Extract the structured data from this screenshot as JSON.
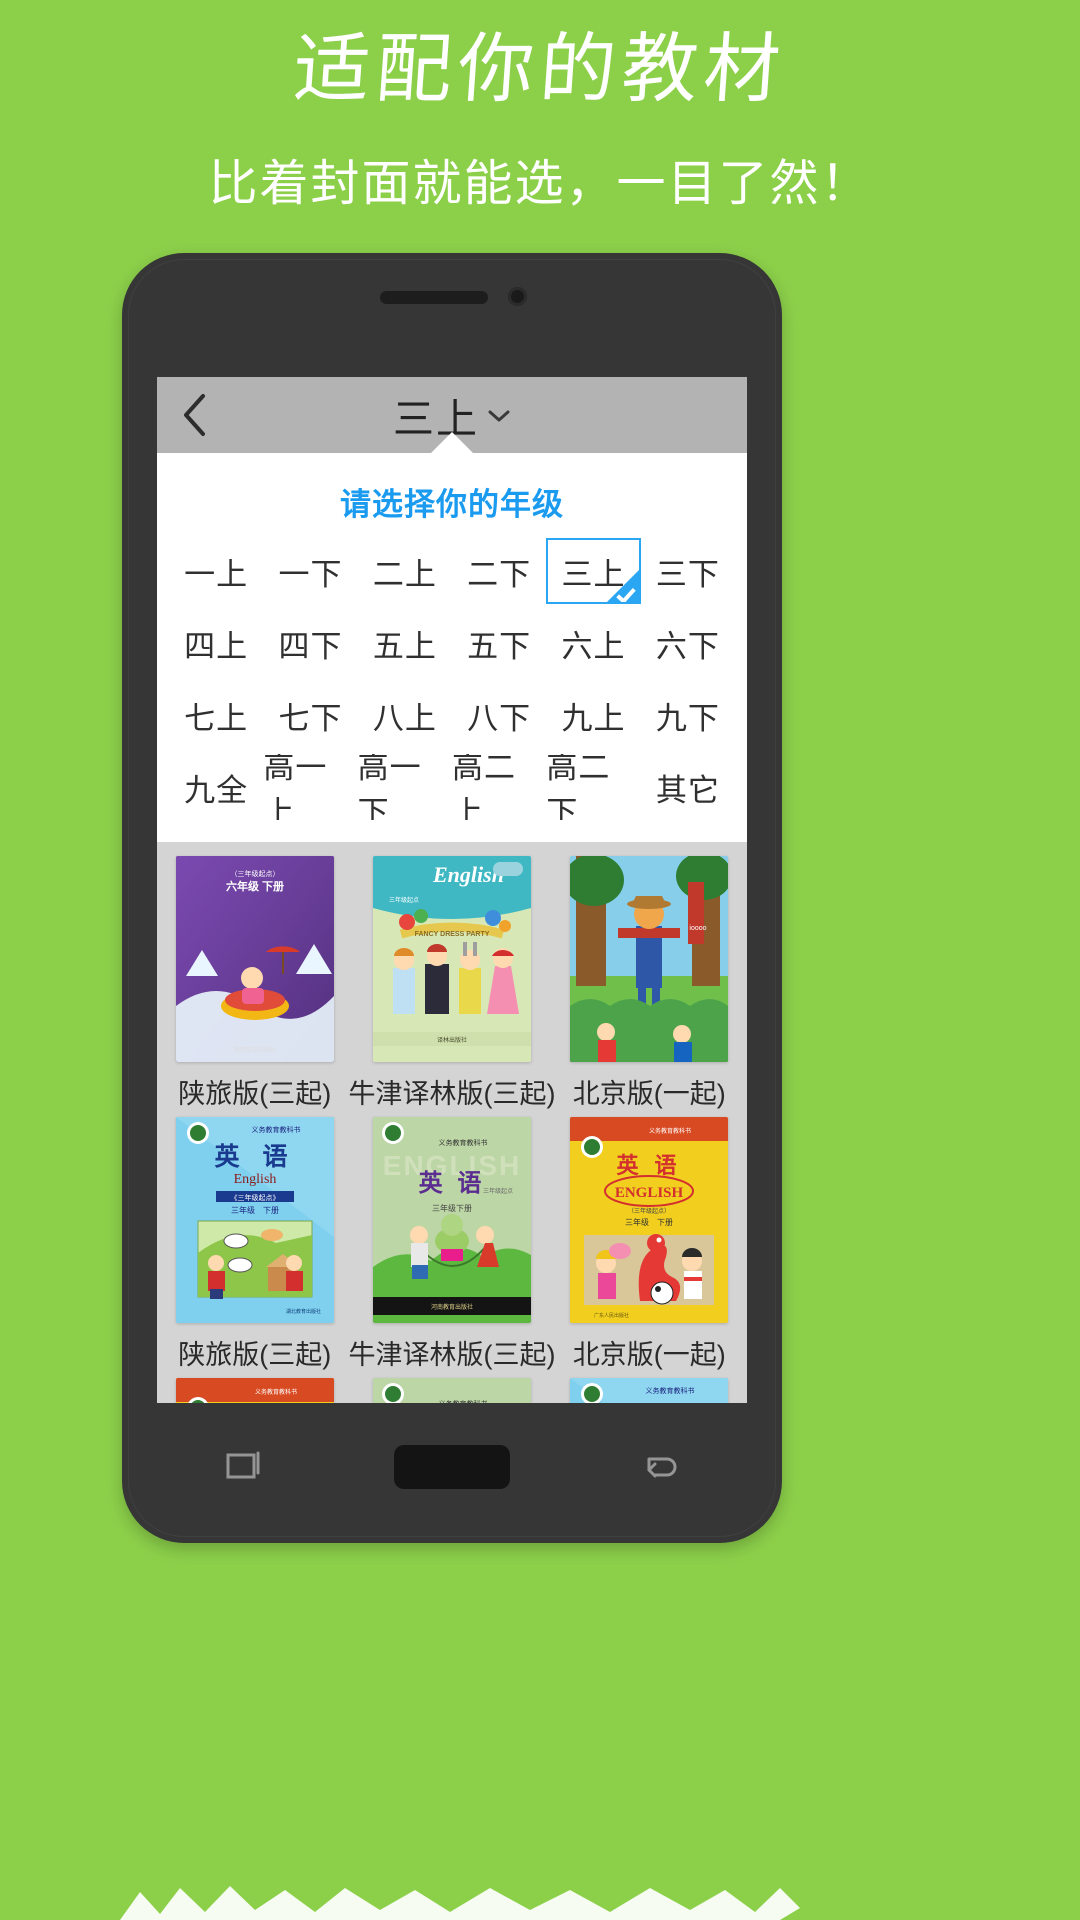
{
  "promo": {
    "title": "适配你的教材",
    "subtitle": "比着封面就能选，一目了然！"
  },
  "colors": {
    "background": "#8CD04A",
    "accent": "#2BA6F2",
    "dialog_title": "#1a9bf0",
    "appbar": "#b3b3b3",
    "screen_bg": "#d4d4d4",
    "phone_frame": "#363636"
  },
  "app": {
    "appbar": {
      "back_icon": "chevron-left-icon",
      "title": "三上",
      "dropdown_icon": "chevron-down-icon"
    },
    "grade_dialog": {
      "title": "请选择你的年级",
      "selected": "三上",
      "grades": [
        "一上",
        "一下",
        "二上",
        "二下",
        "三上",
        "三下",
        "四上",
        "四下",
        "五上",
        "五下",
        "六上",
        "六下",
        "七上",
        "七下",
        "八上",
        "八下",
        "九上",
        "九下",
        "九全",
        "高一上",
        "高一下",
        "高二上",
        "高二下",
        "其它"
      ]
    },
    "books": {
      "rows": [
        {
          "items": [
            {
              "label": "陕旅版(三起)",
              "cover": "purple-snow-sled"
            },
            {
              "label": "牛津译林版(三起)",
              "cover": "green-fancy-dress-party"
            },
            {
              "label": "北京版(一起)",
              "cover": "scarecrow-forest"
            }
          ]
        },
        {
          "items": [
            {
              "label": "陕旅版(三起)",
              "cover": "blue-english-farm"
            },
            {
              "label": "牛津译林版(三起)",
              "cover": "green-english-jumprope"
            },
            {
              "label": "北京版(一起)",
              "cover": "yellow-english-dragon"
            }
          ]
        },
        {
          "items": [
            {
              "label": "",
              "cover": "yellow-english-dragon"
            },
            {
              "label": "",
              "cover": "green-english-jumprope"
            },
            {
              "label": "",
              "cover": "blue-english-farm"
            }
          ]
        }
      ]
    },
    "navbar": {
      "recents_icon": "recents-square-icon",
      "home_icon": "home-pill-icon",
      "back_icon": "back-arrow-icon"
    }
  }
}
